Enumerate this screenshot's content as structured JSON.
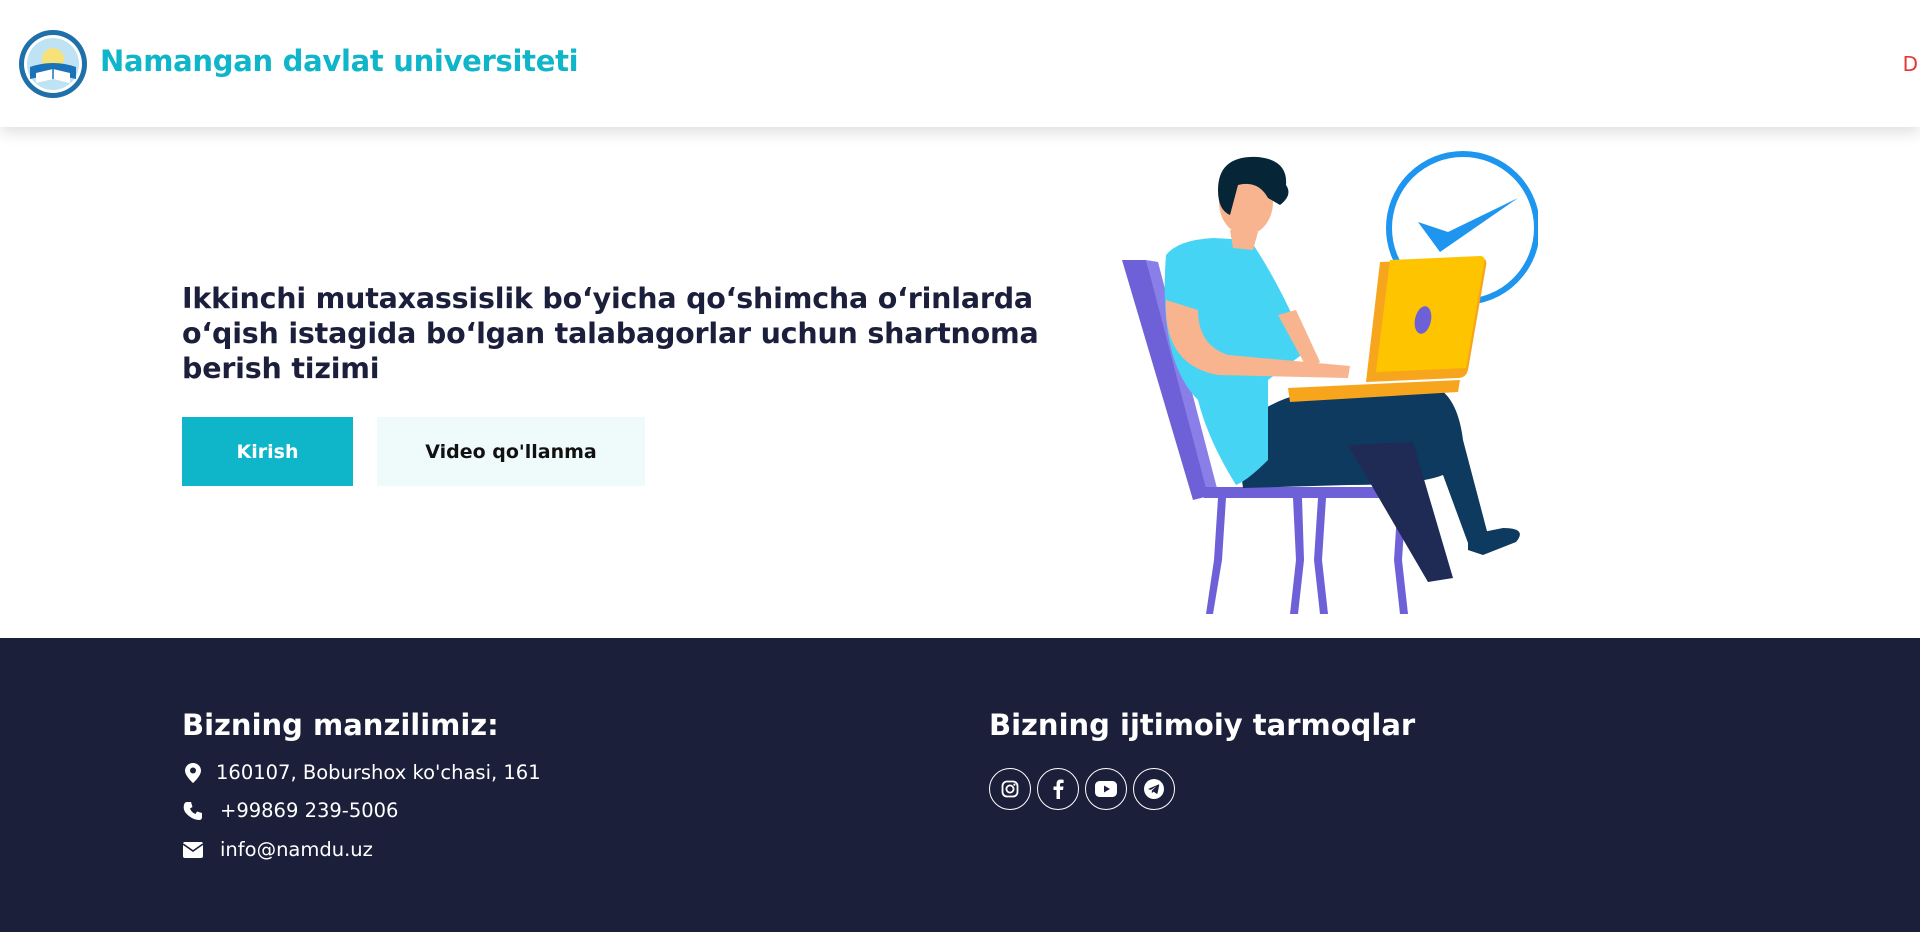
{
  "header": {
    "brand": "Namangan davlat universiteti",
    "lang": "D",
    "logo_icon": "university-seal-logo"
  },
  "hero": {
    "title": "Ikkinchi mutaxassislik bo‘yicha qo‘shimcha o‘rinlarda o‘qish istagida bo‘lgan talabagorlar uchun shartnoma berish tizimi",
    "login_label": "Kirish",
    "video_label": "Video qo'llanma",
    "illustration": "man-with-laptop-checkmark-illustration"
  },
  "footer": {
    "address_title": "Bizning manzilimiz:",
    "address": "160107, Boburshox ko'chasi, 161",
    "phone": "+99869 239-5006",
    "email": "info@namdu.uz",
    "social_title": "Bizning ijtimoiy tarmoqlar",
    "socials": [
      "instagram-icon",
      "facebook-icon",
      "youtube-icon",
      "telegram-icon"
    ]
  },
  "colors": {
    "accent": "#0fb5c9",
    "footer_bg": "#1b1f3a",
    "title_text": "#1b1f3b",
    "secondary_btn_bg": "#effafb",
    "lang_text": "#e53935"
  }
}
